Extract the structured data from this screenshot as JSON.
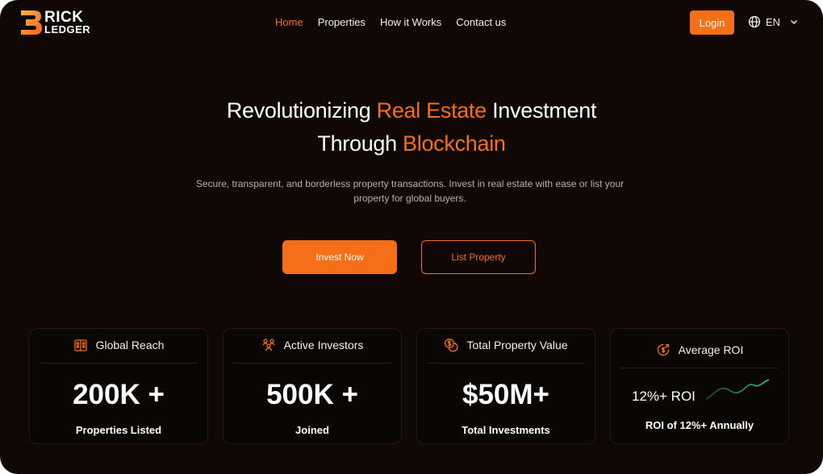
{
  "brand": {
    "line1": "RICK",
    "line2": "LEDGER",
    "accent": "#f46f17"
  },
  "nav": {
    "items": [
      {
        "label": "Home",
        "active": true
      },
      {
        "label": "Properties",
        "active": false
      },
      {
        "label": "How it Works",
        "active": false
      },
      {
        "label": "Contact us",
        "active": false
      }
    ],
    "login_label": "Login",
    "language": {
      "value": "EN",
      "icon": "globe-icon"
    }
  },
  "hero": {
    "title_line1_a": "Revolutionizing ",
    "title_line1_hl": "Real Estate",
    "title_line1_b": " Investment",
    "title_line2_a": "Through ",
    "title_line2_hl": "Blockchain",
    "subtitle": "Secure, transparent, and borderless property transactions. Invest in real estate with ease or list your property for global buyers.",
    "primary_cta": "Invest Now",
    "secondary_cta": "List Property"
  },
  "stats": [
    {
      "icon": "building-icon",
      "title": "Global Reach",
      "value": "200K +",
      "label": "Properties Listed"
    },
    {
      "icon": "investors-icon",
      "title": "Active Investors",
      "value": "500K +",
      "label": "Joined"
    },
    {
      "icon": "coins-icon",
      "title": "Total Property Value",
      "value": "$50M+",
      "label": "Total Investments"
    },
    {
      "icon": "roi-icon",
      "title": "Average ROI",
      "value": "12%+ ROI",
      "label": "ROI of 12%+ Annually",
      "spark_color": "#2ec79a"
    }
  ]
}
